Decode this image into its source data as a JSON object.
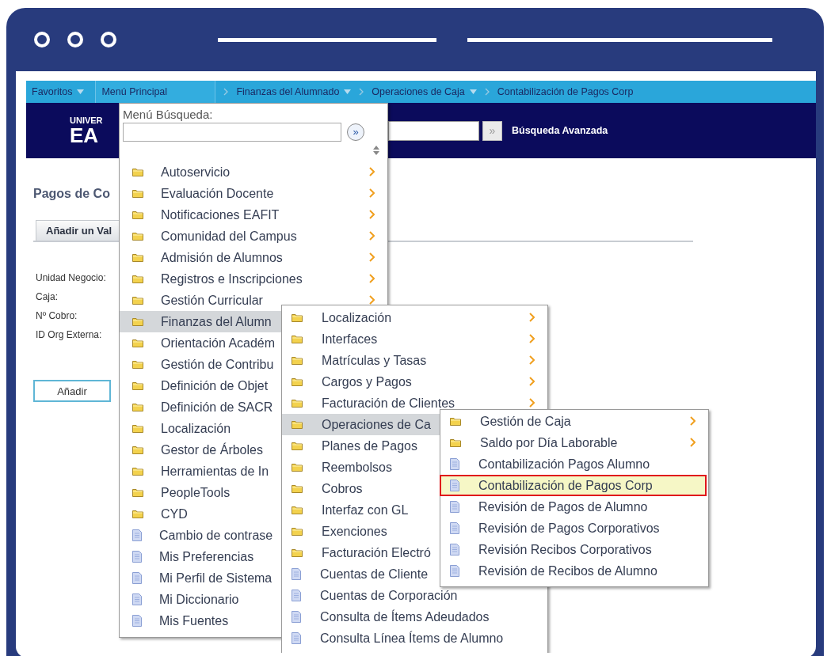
{
  "nav_bar": {
    "items": [
      {
        "label": "Favoritos",
        "dropdown": true,
        "selected": false
      },
      {
        "label": "Menú Principal",
        "dropdown": false,
        "selected": true
      }
    ],
    "breadcrumbs": [
      {
        "label": "Finanzas del Alumnado",
        "dropdown": true
      },
      {
        "label": "Operaciones de Caja",
        "dropdown": true
      },
      {
        "label": "Contabilización de Pagos Corp",
        "dropdown": false
      }
    ]
  },
  "header": {
    "logo": [
      "UNIVER",
      "EA"
    ],
    "search_button": "»",
    "advanced_search": "Búsqueda Avanzada"
  },
  "page": {
    "title": "Pagos de Co",
    "tabs": [
      {
        "label": "Añadir un Val"
      }
    ],
    "fields": [
      "Unidad Negocio:",
      "Caja:",
      "Nº Cobro:",
      "ID Org Externa:"
    ],
    "button": "Añadir"
  },
  "menus": [
    {
      "search_label": "Menú Búsqueda:",
      "search_button": "»",
      "items": [
        {
          "label": "Autoservicio",
          "kind": "folder",
          "submenu": true,
          "selected": false
        },
        {
          "label": "Evaluación Docente",
          "kind": "folder",
          "submenu": true,
          "selected": false
        },
        {
          "label": "Notificaciones EAFIT",
          "kind": "folder",
          "submenu": true,
          "selected": false
        },
        {
          "label": "Comunidad del Campus",
          "kind": "folder",
          "submenu": true,
          "selected": false
        },
        {
          "label": "Admisión de Alumnos",
          "kind": "folder",
          "submenu": true,
          "selected": false
        },
        {
          "label": "Registros e Inscripciones",
          "kind": "folder",
          "submenu": true,
          "selected": false
        },
        {
          "label": "Gestión Curricular",
          "kind": "folder",
          "submenu": true,
          "selected": false
        },
        {
          "label": "Finanzas del Alumn",
          "kind": "folder",
          "selected": true
        },
        {
          "label": "Orientación Académ",
          "kind": "folder",
          "selected": false
        },
        {
          "label": "Gestión de Contribu",
          "kind": "folder",
          "selected": false
        },
        {
          "label": "Definición de Objet",
          "kind": "folder",
          "selected": false
        },
        {
          "label": "Definición de SACR",
          "kind": "folder",
          "selected": false
        },
        {
          "label": "Localización",
          "kind": "folder",
          "selected": false
        },
        {
          "label": "Gestor de Árboles",
          "kind": "folder",
          "selected": false
        },
        {
          "label": "Herramientas de In",
          "kind": "folder",
          "selected": false
        },
        {
          "label": "PeopleTools",
          "kind": "folder",
          "selected": false
        },
        {
          "label": "CYD",
          "kind": "folder",
          "selected": false
        },
        {
          "label": "Cambio de contrase",
          "kind": "page",
          "selected": false
        },
        {
          "label": "Mis Preferencias",
          "kind": "page",
          "selected": false
        },
        {
          "label": "Mi Perfil de Sistema",
          "kind": "page",
          "selected": false
        },
        {
          "label": "Mi Diccionario",
          "kind": "page",
          "selected": false
        },
        {
          "label": "Mis Fuentes",
          "kind": "page",
          "selected": false
        }
      ]
    },
    {
      "items": [
        {
          "label": "Localización",
          "kind": "folder",
          "submenu": true,
          "selected": false
        },
        {
          "label": "Interfaces",
          "kind": "folder",
          "submenu": true,
          "selected": false
        },
        {
          "label": "Matrículas y Tasas",
          "kind": "folder",
          "submenu": true,
          "selected": false
        },
        {
          "label": "Cargos y Pagos",
          "kind": "folder",
          "submenu": true,
          "selected": false
        },
        {
          "label": "Facturación de Clientes",
          "kind": "folder",
          "submenu": true,
          "selected": false
        },
        {
          "label": "Operaciones de Ca",
          "kind": "folder",
          "selected": true
        },
        {
          "label": "Planes de Pagos",
          "kind": "folder",
          "selected": false
        },
        {
          "label": "Reembolsos",
          "kind": "folder",
          "selected": false
        },
        {
          "label": "Cobros",
          "kind": "folder",
          "selected": false
        },
        {
          "label": "Interfaz con GL",
          "kind": "folder",
          "selected": false
        },
        {
          "label": "Exenciones",
          "kind": "folder",
          "selected": false
        },
        {
          "label": "Facturación Electró",
          "kind": "folder",
          "selected": false
        },
        {
          "label": "Cuentas de Cliente",
          "kind": "page",
          "selected": false
        },
        {
          "label": "Cuentas de Corporación",
          "kind": "page",
          "submenu": false,
          "selected": false
        },
        {
          "label": "Consulta de Ítems Adeudados",
          "kind": "page",
          "submenu": false,
          "selected": false
        },
        {
          "label": "Consulta Línea Ítems de Alumno",
          "kind": "page",
          "submenu": false,
          "selected": false
        }
      ]
    },
    {
      "items": [
        {
          "label": "Gestión de Caja",
          "kind": "folder",
          "submenu": true,
          "highlighted": false
        },
        {
          "label": "Saldo por Día Laborable",
          "kind": "folder",
          "submenu": true,
          "highlighted": false
        },
        {
          "label": "Contabilización Pagos Alumno",
          "kind": "page",
          "submenu": false,
          "highlighted": false
        },
        {
          "label": "Contabilización de Pagos Corp",
          "kind": "page",
          "submenu": false,
          "highlighted": true
        },
        {
          "label": "Revisión de Pagos de Alumno",
          "kind": "page",
          "submenu": false,
          "highlighted": false
        },
        {
          "label": "Revisión de Pagos Corporativos",
          "kind": "page",
          "submenu": false,
          "highlighted": false
        },
        {
          "label": "Revisión Recibos Corporativos",
          "kind": "page",
          "submenu": false,
          "highlighted": false
        },
        {
          "label": "Revisión de Recibos de Alumno",
          "kind": "page",
          "submenu": false,
          "highlighted": false
        }
      ]
    }
  ]
}
